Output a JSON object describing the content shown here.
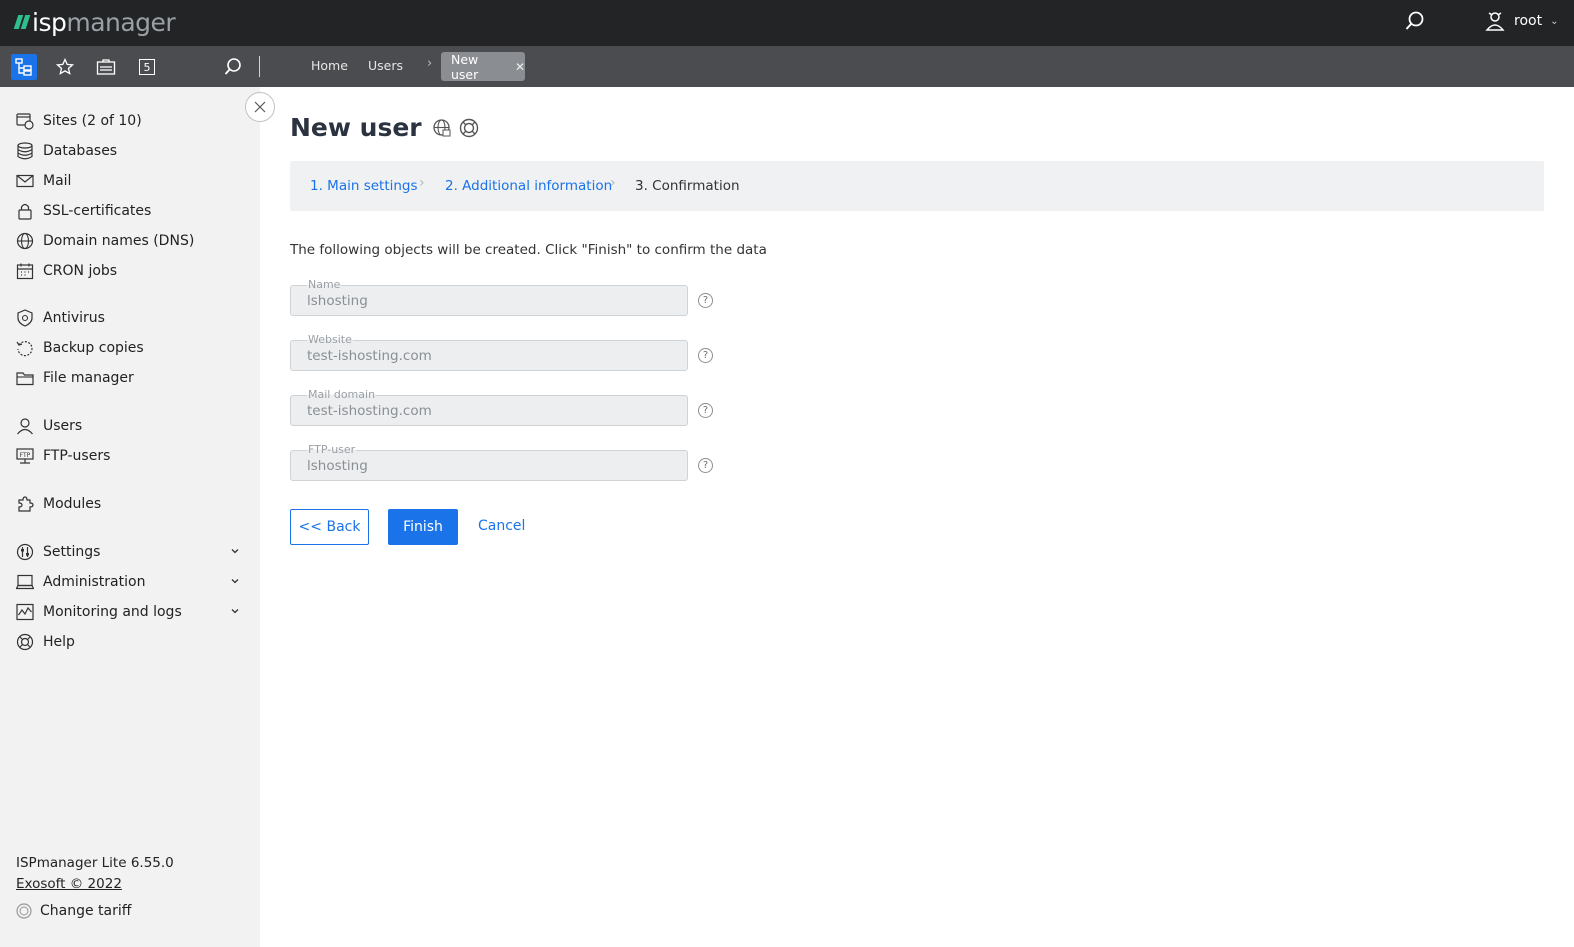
{
  "app": {
    "logo_prefix": "isp",
    "logo_suffix": "manager",
    "user_name": "root"
  },
  "navbar": {
    "notification_count": "5",
    "breadcrumbs": [
      "Home",
      "Users"
    ],
    "active_tab": "New user"
  },
  "sidebar": {
    "items": [
      {
        "label": "Sites (2 of 10)",
        "icon": "sites-icon"
      },
      {
        "label": "Databases",
        "icon": "database-icon"
      },
      {
        "label": "Mail",
        "icon": "mail-icon"
      },
      {
        "label": "SSL-certificates",
        "icon": "lock-icon"
      },
      {
        "label": "Domain names (DNS)",
        "icon": "globe-icon"
      },
      {
        "label": "CRON jobs",
        "icon": "calendar-icon"
      },
      {
        "label": "Antivirus",
        "icon": "shield-icon"
      },
      {
        "label": "Backup copies",
        "icon": "backup-icon"
      },
      {
        "label": "File manager",
        "icon": "folder-icon"
      },
      {
        "label": "Users",
        "icon": "user-icon"
      },
      {
        "label": "FTP-users",
        "icon": "ftp-icon"
      },
      {
        "label": "Modules",
        "icon": "puzzle-icon"
      },
      {
        "label": "Settings",
        "icon": "settings-icon"
      },
      {
        "label": "Administration",
        "icon": "monitor-icon"
      },
      {
        "label": "Monitoring and logs",
        "icon": "chart-icon"
      },
      {
        "label": "Help",
        "icon": "lifebuoy-icon"
      }
    ],
    "version": "ISPmanager Lite 6.55.0",
    "copyright": "Exosoft © 2022",
    "change_tariff": "Change tariff"
  },
  "main": {
    "title": "New user",
    "steps": [
      "1. Main settings",
      "2. Additional information",
      "3. Confirmation"
    ],
    "intro": "The following objects will be created. Click \"Finish\" to confirm the data",
    "fields": [
      {
        "label": "Name",
        "value": "lshosting"
      },
      {
        "label": "Website",
        "value": "test-ishosting.com"
      },
      {
        "label": "Mail domain",
        "value": "test-ishosting.com"
      },
      {
        "label": "FTP-user",
        "value": "lshosting"
      }
    ],
    "buttons": {
      "back": "<< Back",
      "finish": "Finish",
      "cancel": "Cancel"
    }
  },
  "colors": {
    "accent": "#1a73e8",
    "topbar": "#222426",
    "navbar": "#4a4c4f",
    "sidebar": "#f2f2f2",
    "logo_mark": "#2fbf8f"
  }
}
